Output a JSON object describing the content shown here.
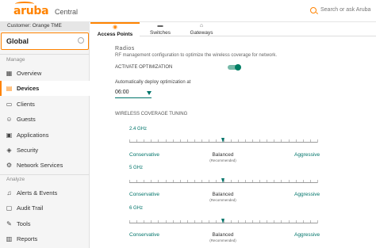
{
  "header": {
    "logo_text": "aruba",
    "product": "Central",
    "search_placeholder": "Search or ask Aruba"
  },
  "sidebar": {
    "customer": "Customer: Orange TME",
    "scope": "Global",
    "sections": {
      "manage": "Manage",
      "analyze": "Analyze"
    },
    "manage_items": [
      {
        "label": "Overview",
        "icon": "overview-icon"
      },
      {
        "label": "Devices",
        "icon": "devices-icon",
        "active": true
      },
      {
        "label": "Clients",
        "icon": "clients-icon"
      },
      {
        "label": "Guests",
        "icon": "guests-icon"
      },
      {
        "label": "Applications",
        "icon": "applications-icon"
      },
      {
        "label": "Security",
        "icon": "security-icon"
      },
      {
        "label": "Network Services",
        "icon": "network-services-icon"
      }
    ],
    "analyze_items": [
      {
        "label": "Alerts & Events",
        "icon": "bell-icon"
      },
      {
        "label": "Audit Trail",
        "icon": "audit-icon"
      },
      {
        "label": "Tools",
        "icon": "tools-icon"
      },
      {
        "label": "Reports",
        "icon": "reports-icon"
      }
    ]
  },
  "tabs": [
    {
      "label": "Access Points",
      "icon": "access-point-icon",
      "active": true
    },
    {
      "label": "Switches",
      "icon": "switch-icon"
    },
    {
      "label": "Gateways",
      "icon": "gateway-icon"
    }
  ],
  "main": {
    "section_title": "Radios",
    "description": "RF management configuration to optimize the wireless coverage for network.",
    "activate_label": "ACTIVATE OPTIMIZATION",
    "activate_on": true,
    "auto_deploy_label": "Automatically deploy optimization at",
    "auto_deploy_time": "06:00",
    "tuning_title": "WIRELESS COVERAGE TUNING",
    "bands": [
      {
        "name": "2.4 GHz",
        "left": "Conservative",
        "middle": "Balanced",
        "recommended": "(Recommended)",
        "right": "Aggressive",
        "level": 0.5
      },
      {
        "name": "5 GHz",
        "left": "Conservative",
        "middle": "Balanced",
        "recommended": "(Recommended)",
        "right": "Aggressive",
        "level": 0.5
      },
      {
        "name": "6 GHz",
        "left": "Conservative",
        "middle": "Balanced",
        "recommended": "(Recommended)",
        "right": "Aggressive",
        "level": 0.5
      }
    ]
  },
  "colors": {
    "accent": "#ff8300",
    "teal": "#00746a"
  }
}
